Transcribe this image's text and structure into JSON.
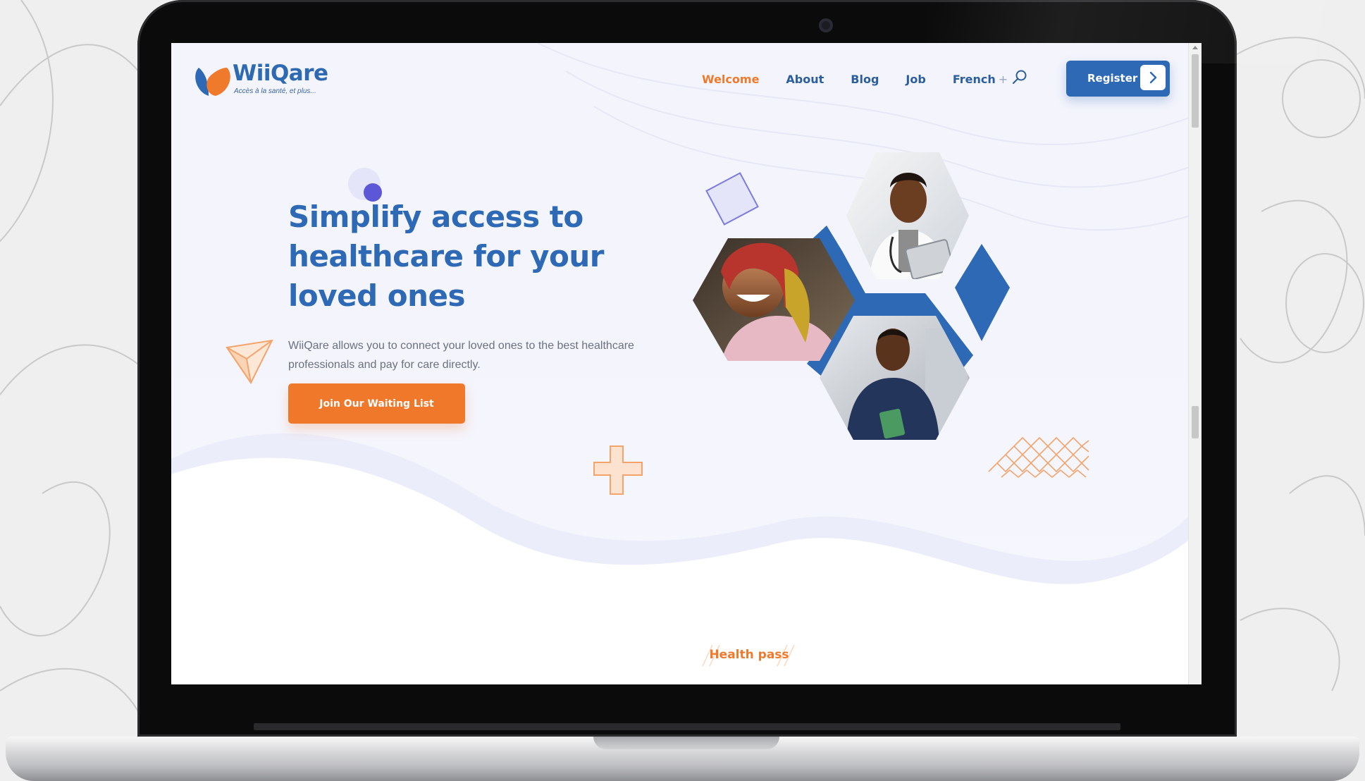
{
  "brand": {
    "name": "WiiQare",
    "tagline": "Accès à la santé, et plus...",
    "primary_color": "#2e69b5",
    "accent_color": "#f07a2c"
  },
  "nav": {
    "items": [
      {
        "label": "Welcome",
        "active": true
      },
      {
        "label": "About",
        "active": false
      },
      {
        "label": "Blog",
        "active": false
      },
      {
        "label": "Job",
        "active": false
      },
      {
        "label": "French",
        "active": false
      }
    ],
    "dropdown_symbol": "+",
    "search_icon": "search-icon",
    "register_label": "Register",
    "register_icon": "chevron-right-icon"
  },
  "hero": {
    "title_line1": "Simplify access to",
    "title_line2": "healthcare for your",
    "title_line3": "loved ones",
    "description_line1": "WiiQare allows you to connect your loved ones to the best healthcare",
    "description_line2": "professionals and pay for care directly.",
    "cta_label": "Join Our Waiting List",
    "images": [
      "doctor-photo",
      "elderly-woman-photo",
      "young-man-photo"
    ]
  },
  "next_section": {
    "label": "Health pass"
  }
}
